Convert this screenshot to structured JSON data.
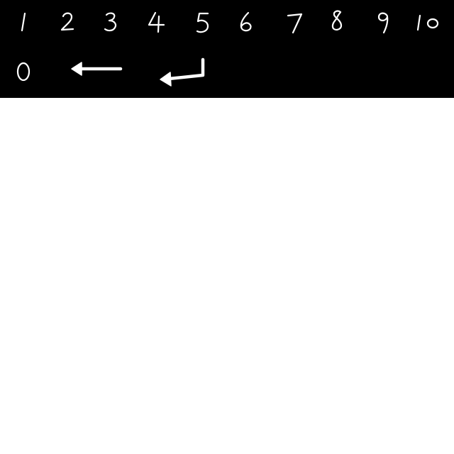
{
  "keypad": {
    "background": "#000000",
    "stroke_color": "#ffffff",
    "row1": [
      {
        "label": "1",
        "icon": "handwritten-digit-1"
      },
      {
        "label": "2",
        "icon": "handwritten-digit-2"
      },
      {
        "label": "3",
        "icon": "handwritten-digit-3"
      },
      {
        "label": "4",
        "icon": "handwritten-digit-4"
      },
      {
        "label": "5",
        "icon": "handwritten-digit-5"
      },
      {
        "label": "6",
        "icon": "handwritten-digit-6"
      },
      {
        "label": "7",
        "icon": "handwritten-digit-7"
      },
      {
        "label": "8",
        "icon": "handwritten-digit-8"
      },
      {
        "label": "9",
        "icon": "handwritten-digit-9"
      },
      {
        "label": "10",
        "icon": "handwritten-number-10"
      }
    ],
    "row2": [
      {
        "label": "0",
        "icon": "handwritten-digit-0"
      },
      {
        "label": "",
        "icon": "backspace-arrow-icon"
      },
      {
        "label": "",
        "icon": "enter-return-icon"
      }
    ]
  },
  "canvas": {
    "background": "#ffffff"
  }
}
